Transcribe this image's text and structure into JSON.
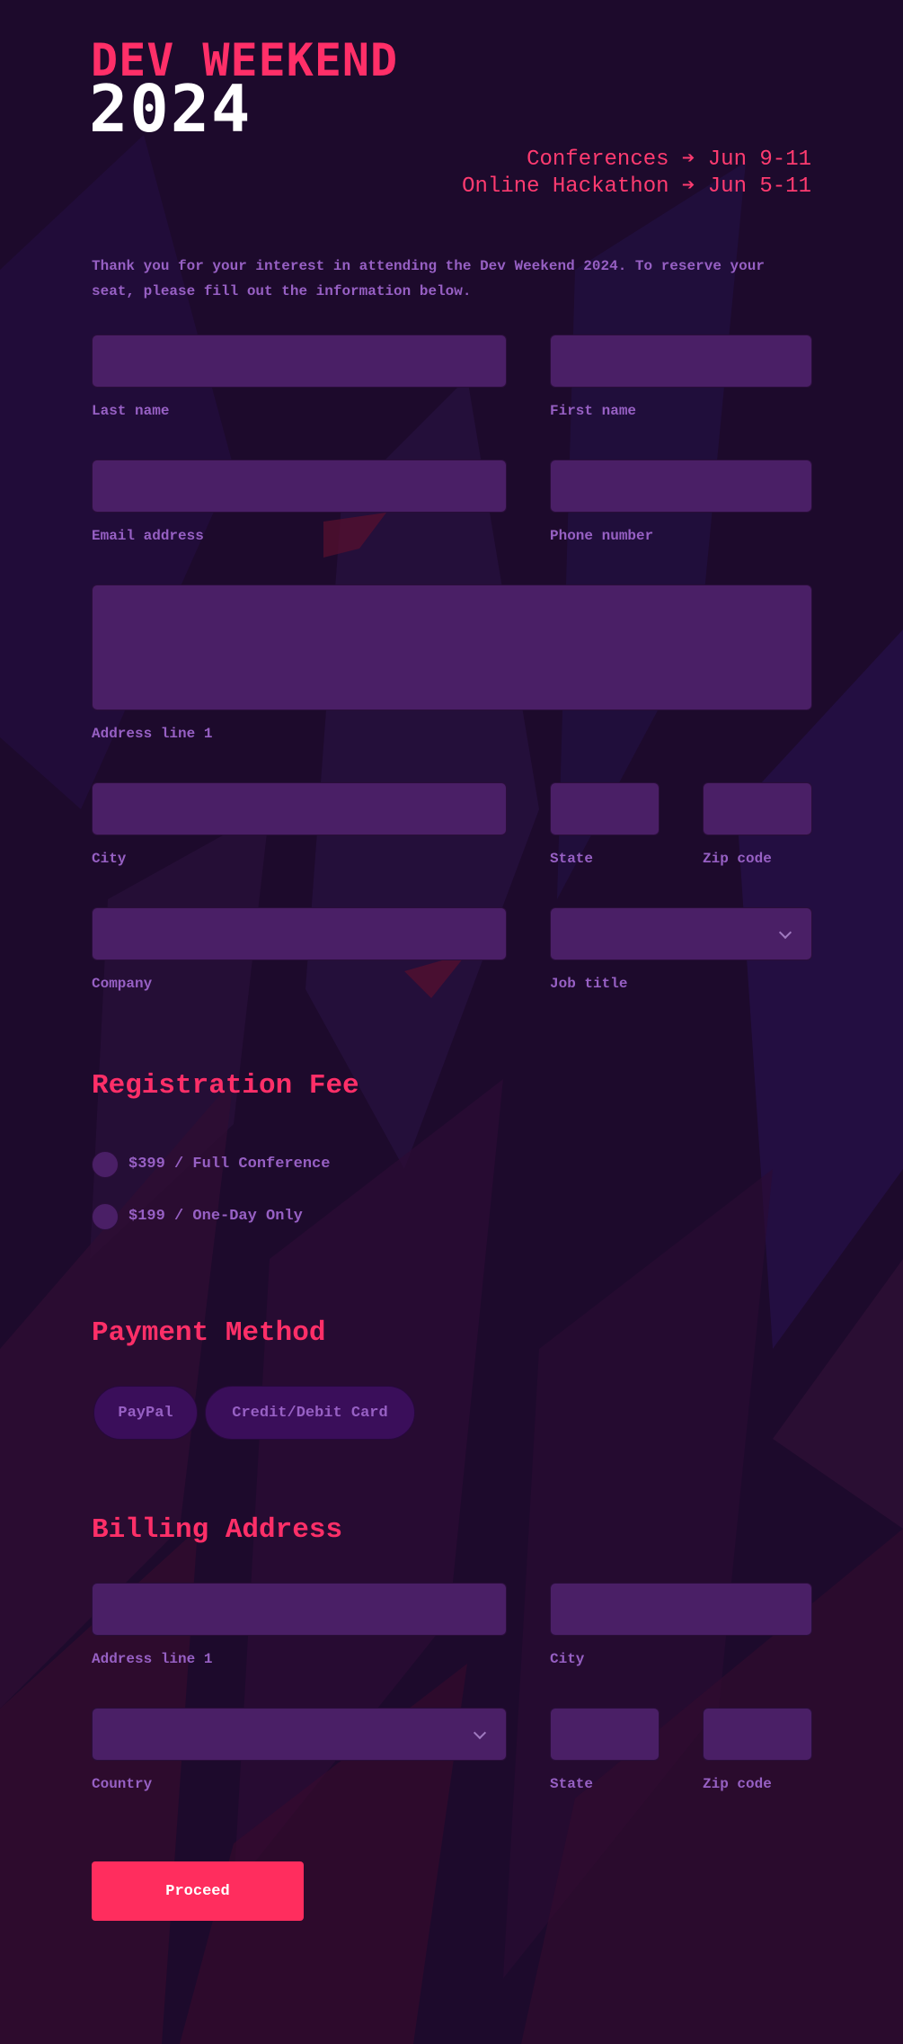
{
  "header": {
    "logo_line1": "DEV WEEKEND",
    "logo_line2": "2024",
    "conferences": "Conferences ➔ Jun 9-11",
    "hackathon": "Online Hackathon ➔ Jun 5-11"
  },
  "intro_text": "Thank you for your interest in attending the Dev Weekend 2024. To reserve your seat, please fill out the information below.",
  "attendee_form": {
    "last_name": {
      "label": "Last name",
      "value": ""
    },
    "first_name": {
      "label": "First name",
      "value": ""
    },
    "email": {
      "label": "Email address",
      "value": ""
    },
    "phone": {
      "label": "Phone number",
      "value": ""
    },
    "address_line1": {
      "label": "Address line 1",
      "value": ""
    },
    "city": {
      "label": "City",
      "value": ""
    },
    "state": {
      "label": "State",
      "value": ""
    },
    "zip": {
      "label": "Zip code",
      "value": ""
    },
    "company": {
      "label": "Company",
      "value": ""
    },
    "job_title": {
      "label": "Job title",
      "selected": ""
    }
  },
  "registration": {
    "title": "Registration Fee",
    "options": [
      {
        "label": "$399 / Full Conference",
        "selected": false
      },
      {
        "label": "$199 / One-Day Only",
        "selected": false
      }
    ]
  },
  "payment": {
    "title": "Payment Method",
    "options": [
      "PayPal",
      "Credit/Debit Card"
    ]
  },
  "billing": {
    "title": "Billing Address",
    "address_line1": {
      "label": "Address line 1",
      "value": ""
    },
    "city": {
      "label": "City",
      "value": ""
    },
    "country": {
      "label": "Country",
      "selected": ""
    },
    "state": {
      "label": "State",
      "value": ""
    },
    "zip": {
      "label": "Zip code",
      "value": ""
    }
  },
  "proceed_label": "Proceed",
  "colors": {
    "background": "#1d0a2c",
    "accent": "#ff2f68",
    "field": "#4a1f66",
    "label": "#9760c4",
    "button": "#ff2d5e"
  }
}
